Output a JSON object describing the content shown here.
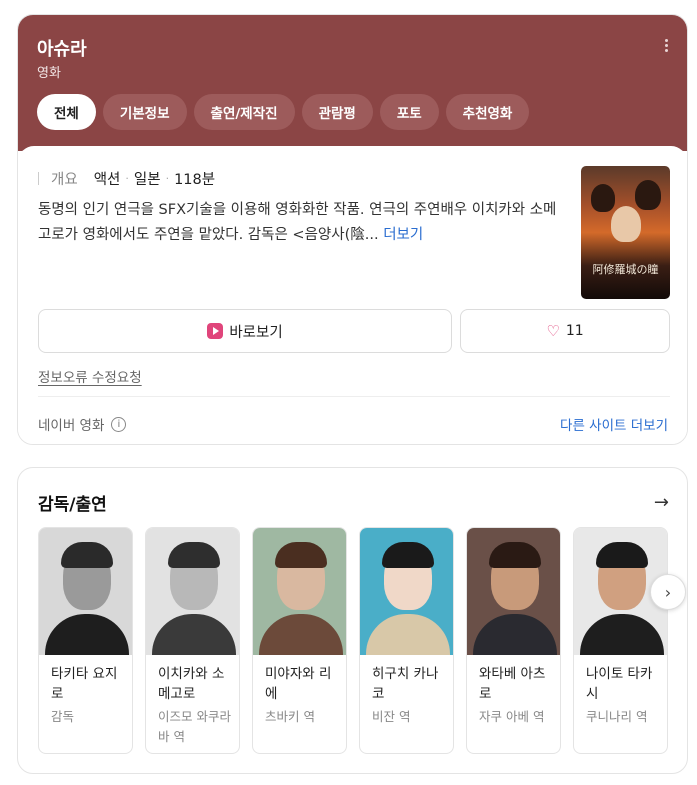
{
  "header": {
    "title": "아슈라",
    "subtitle": "영화",
    "tabs": [
      {
        "label": "전체",
        "active": true
      },
      {
        "label": "기본정보",
        "active": false
      },
      {
        "label": "출연/제작진",
        "active": false
      },
      {
        "label": "관람평",
        "active": false
      },
      {
        "label": "포토",
        "active": false
      },
      {
        "label": "추천영화",
        "active": false
      }
    ],
    "accent_color": "#8b4545"
  },
  "summary": {
    "overview_label": "개요",
    "genre": "액션",
    "country": "일본",
    "runtime": "118분",
    "description": "동명의 인기 연극을 SFX기술을 이용해 영화화한 작품. 연극의 주연배우 이치카와 소메고로가 영화에서도 주연을 맡았다. 감독은 <음양사(陰...",
    "more_label": "더보기",
    "poster_title": "阿修羅城の瞳"
  },
  "actions": {
    "watch_label": "바로보기",
    "like_count": "11",
    "report_label": "정보오류 수정요청",
    "source_label": "네이버 영화",
    "other_sites_label": "다른 사이트 더보기"
  },
  "cast_section": {
    "title": "감독/출연",
    "people": [
      {
        "name": "타키타 요지로",
        "role": "감독"
      },
      {
        "name": "이치카와 소메고로",
        "role": "이즈모 와쿠라바 역"
      },
      {
        "name": "미야자와 리에",
        "role": "츠바키 역"
      },
      {
        "name": "히구치 카나코",
        "role": "비잔 역"
      },
      {
        "name": "와타베 아츠로",
        "role": "자쿠 아베 역"
      },
      {
        "name": "나이토 타카시",
        "role": "쿠니나리 역"
      }
    ]
  },
  "icons": {
    "menu": "more-vertical-icon",
    "watch": "play-icon",
    "like": "heart-icon",
    "info": "info-icon",
    "arrow": "arrow-right-icon",
    "next": "chevron-right-icon"
  }
}
